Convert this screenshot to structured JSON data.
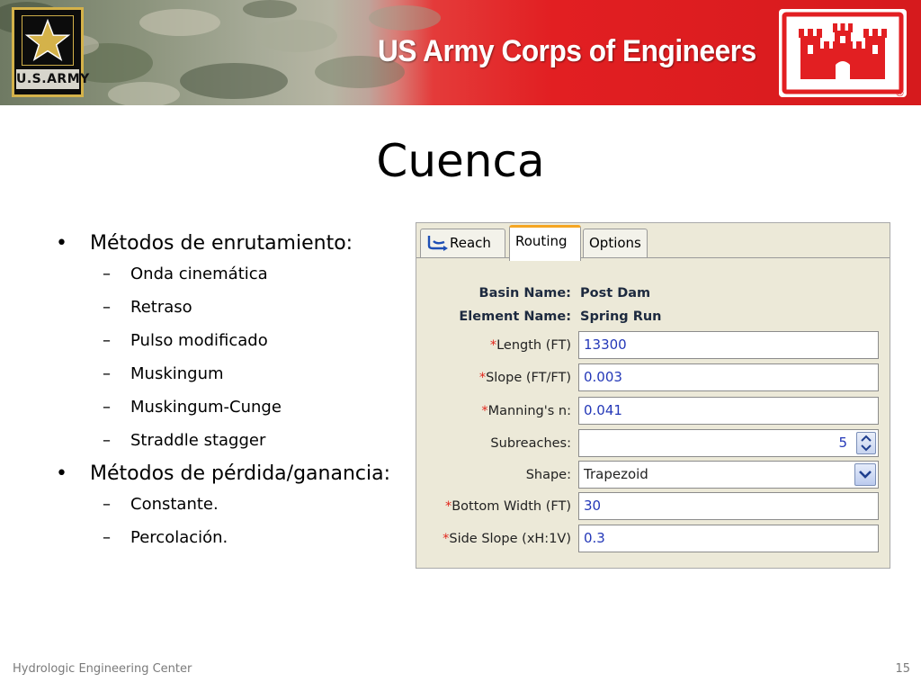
{
  "header": {
    "army_logo_text": "U.S.ARMY",
    "corps_title": "US Army Corps of Engineers",
    "registered_mark": "®"
  },
  "slide": {
    "title": "Cuenca",
    "bullets": [
      {
        "label": "Métodos de enrutamiento:",
        "subitems": [
          "Onda cinemática",
          "Retraso",
          "Pulso modificado",
          "Muskingum",
          "Muskingum-Cunge",
          "Straddle stagger"
        ]
      },
      {
        "label": "Métodos de pérdida/ganancia:",
        "subitems": [
          "Constante.",
          "Percolación."
        ]
      }
    ]
  },
  "dialog": {
    "tabs": [
      {
        "label": "Reach",
        "icon": "reach-icon"
      },
      {
        "label": "Routing",
        "active": true
      },
      {
        "label": "Options"
      }
    ],
    "basin_name_label": "Basin Name:",
    "basin_name_value": "Post Dam",
    "element_name_label": "Element Name:",
    "element_name_value": "Spring Run",
    "required_mark": "*",
    "length_label": "Length (FT)",
    "length_value": "13300",
    "slope_label": "Slope (FT/FT)",
    "slope_value": "0.003",
    "manning_label": "Manning's n:",
    "manning_value": "0.041",
    "subreaches_label": "Subreaches:",
    "subreaches_value": "5",
    "shape_label": "Shape:",
    "shape_value": "Trapezoid",
    "bottom_width_label": "Bottom Width (FT)",
    "bottom_width_value": "30",
    "side_slope_label": "Side Slope (xH:1V)",
    "side_slope_value": "0.3"
  },
  "footer": {
    "organization": "Hydrologic Engineering Center",
    "page_number": "15"
  },
  "colors": {
    "banner_red": "#e21f22",
    "required_red": "#e1261c",
    "value_blue": "#2438b8",
    "routing_tab_accent": "#f5a623",
    "army_gold": "#d4b24a"
  }
}
